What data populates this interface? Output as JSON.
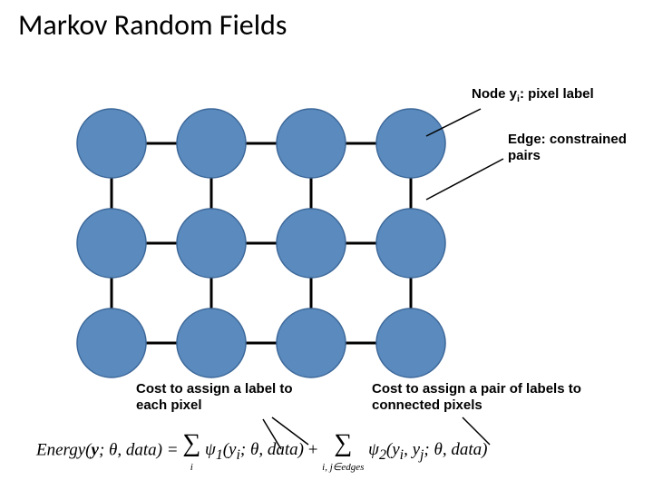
{
  "title": "Markov Random Fields",
  "labels": {
    "node": "Node y<sub>i</sub>: pixel label",
    "edge": "Edge: constrained pairs",
    "cost_unary": "Cost to assign a label to each pixel",
    "cost_pairwise": "Cost to assign a pair of labels to connected pixels"
  },
  "diagram": {
    "rows": 3,
    "cols": 4,
    "spacing": 110,
    "node_radius": 38,
    "node_fill": "#5B8BBE",
    "node_stroke": "#3C6799",
    "edge_color": "#000000"
  },
  "formula_parts": {
    "lhs": "Energy(<b>y</b>; θ, data) = ",
    "sum1_sub": "i",
    "psi1": "ψ<sub>1</sub>(y<sub>i</sub>; θ, data)",
    "plus": " + ",
    "sum2_sub": "i, j∈edges",
    "psi2": "ψ<sub>2</sub>(y<sub>i</sub>, y<sub>j</sub>; θ, data)"
  }
}
